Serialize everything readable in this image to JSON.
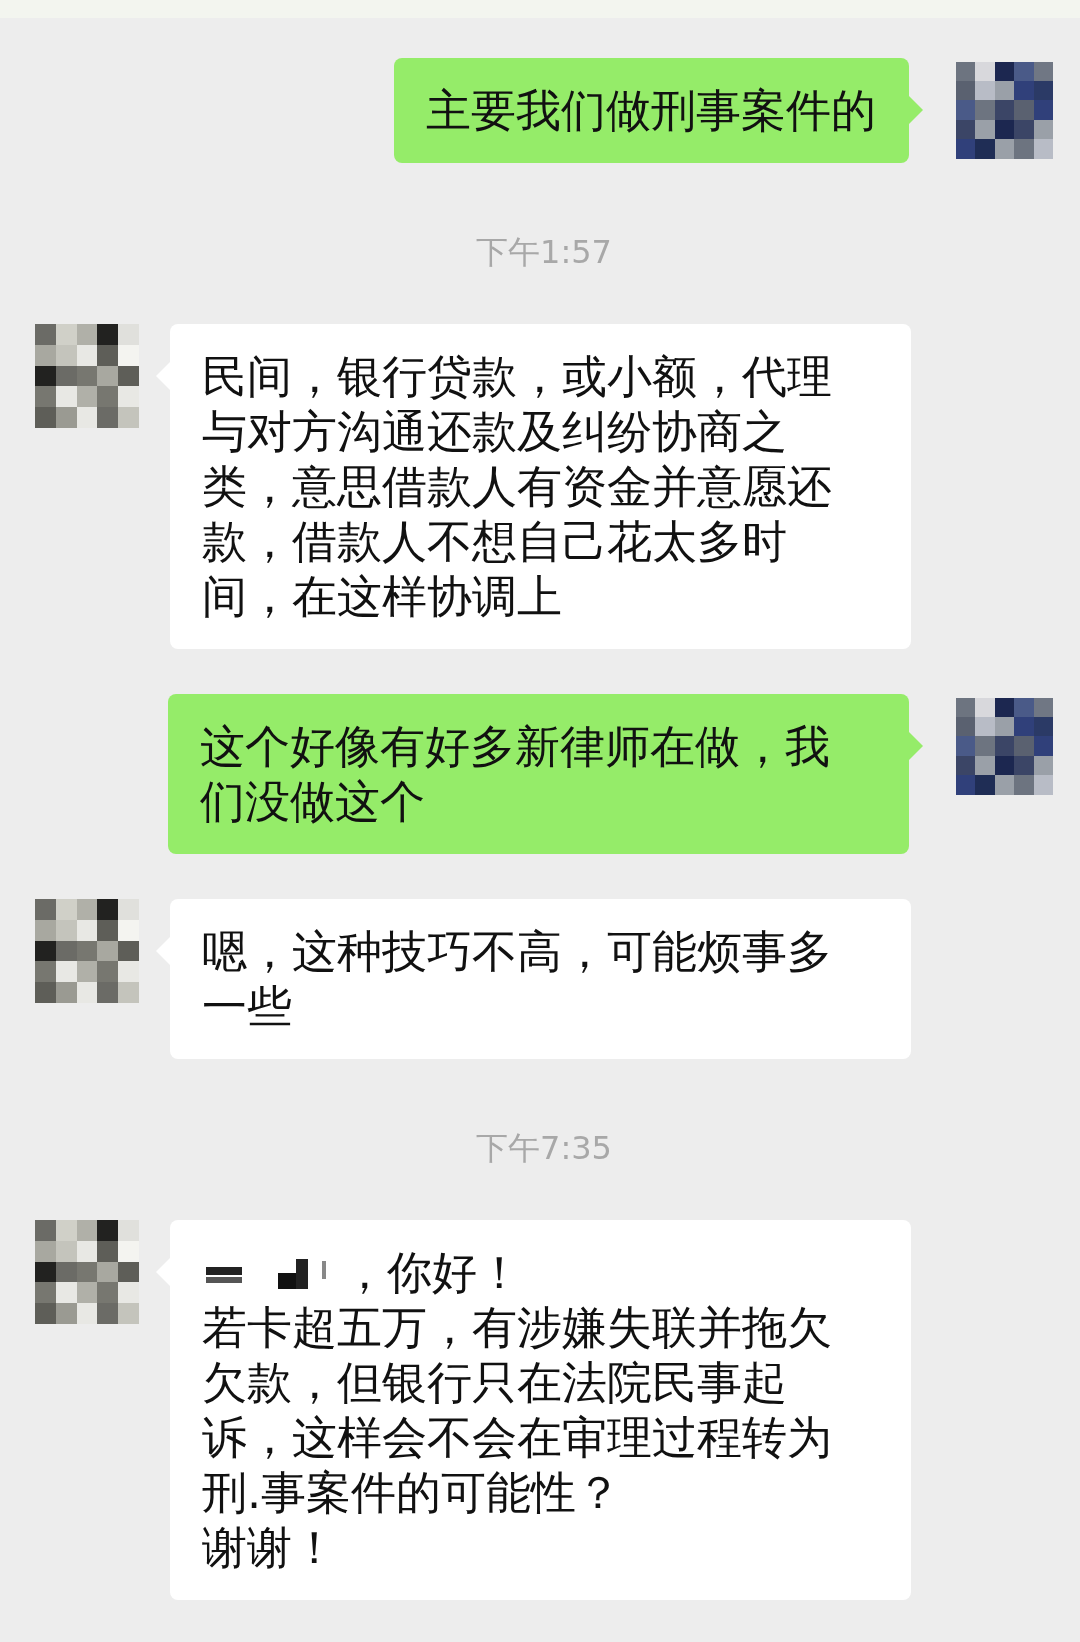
{
  "messages": [
    {
      "kind": "sent",
      "lines": [
        "主要我们做刑事案件的"
      ]
    },
    {
      "kind": "time",
      "text": "下午1:57"
    },
    {
      "kind": "received",
      "lines": [
        "民间，银行贷款，或小额，代理与对方沟通还款及纠纷协商之类，意思借款人有资金并意愿还款，借款人不想自己花太多时间，在这样协调上"
      ]
    },
    {
      "kind": "sent",
      "lines": [
        "这个好像有好多新律师在做，我们没做这个"
      ]
    },
    {
      "kind": "received",
      "lines": [
        "嗯，这种技巧不高，可能烦事多一些"
      ]
    },
    {
      "kind": "time",
      "text": "下午7:35"
    },
    {
      "kind": "received",
      "redacted_name": true,
      "lines": [
        "，你好！",
        "若卡超五万，有涉嫌失联并拖欠欠款，但银行只在法院民事起诉，这样会不会在审理过程转为刑.事案件的可能性？",
        "谢谢！"
      ]
    }
  ]
}
